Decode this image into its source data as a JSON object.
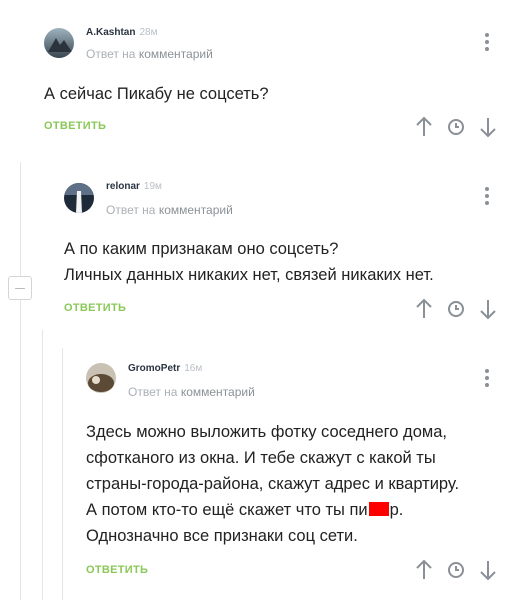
{
  "comments": [
    {
      "author": "A.Kashtan",
      "time": "28м",
      "reply_prefix": "Ответ на",
      "reply_target": "комментарий",
      "text_lines": [
        "А сейчас Пикабу не соцсеть?"
      ],
      "reply_label": "ОТВЕТИТЬ"
    },
    {
      "author": "relonar",
      "time": "19м",
      "reply_prefix": "Ответ на",
      "reply_target": "комментарий",
      "text_lines": [
        "А по каким признакам оно соцсеть?",
        "Личных данных никаких нет, связей никаких нет."
      ],
      "reply_label": "ОТВЕТИТЬ"
    },
    {
      "author": "GromoPetr",
      "time": "16м",
      "reply_prefix": "Ответ на",
      "reply_target": "комментарий",
      "text_lines": [
        "Здесь можно выложить фотку соседнего дома,",
        "сфотканого из окна. И тебе скажут с какой ты",
        "страны-города-района, скажут адрес и квартиру.",
        "А потом кто-то ещё скажет что ты пи",
        "Однозначно все признаки соц сети."
      ],
      "text_line4_end": "р.",
      "reply_label": "ОТВЕТИТЬ"
    }
  ],
  "icons": {
    "upvote": "arrow-up-icon",
    "save": "clock-icon",
    "downvote": "arrow-down-icon",
    "menu": "more-vertical-icon",
    "collapse": "minus-icon"
  },
  "colors": {
    "reply_button": "#8ac858",
    "icon": "#8a9096",
    "censor": "#ff0000"
  }
}
